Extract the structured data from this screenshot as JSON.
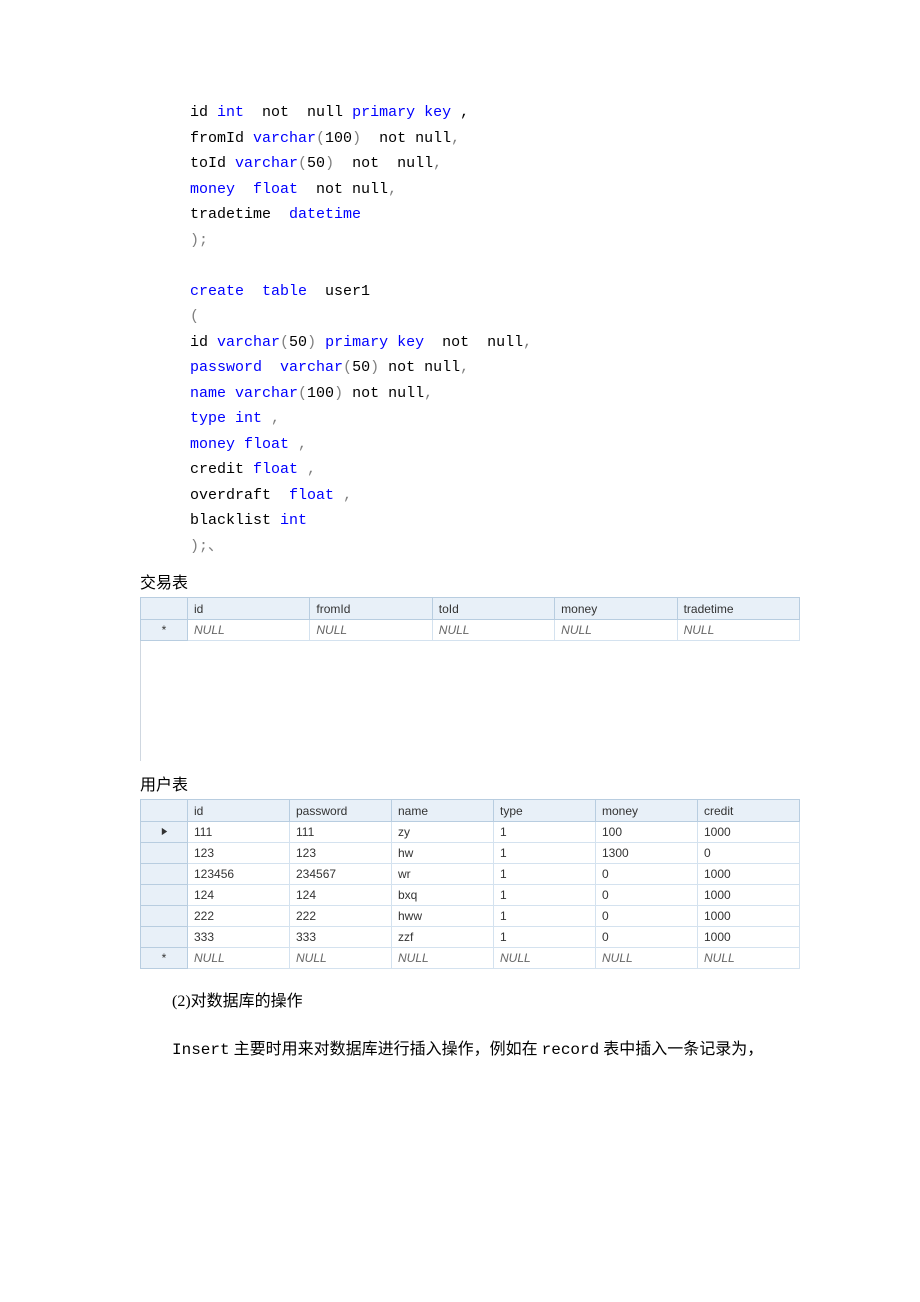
{
  "code_lines": [
    [
      [
        "black",
        "id "
      ],
      [
        "kw",
        "int"
      ],
      [
        "black",
        "  not  null "
      ],
      [
        "kw",
        "primary key"
      ],
      [
        "black",
        " ,"
      ]
    ],
    [
      [
        "black",
        "fromId "
      ],
      [
        "kw",
        "varchar"
      ],
      [
        "gray",
        "("
      ],
      [
        "black",
        "100"
      ],
      [
        "gray",
        ")"
      ],
      [
        "black",
        "  not null"
      ],
      [
        "gray",
        ","
      ]
    ],
    [
      [
        "black",
        "toId "
      ],
      [
        "kw",
        "varchar"
      ],
      [
        "gray",
        "("
      ],
      [
        "black",
        "50"
      ],
      [
        "gray",
        ")"
      ],
      [
        "black",
        "  not  null"
      ],
      [
        "gray",
        ","
      ]
    ],
    [
      [
        "kw",
        "money"
      ],
      [
        "black",
        "  "
      ],
      [
        "kw",
        "float"
      ],
      [
        "black",
        "  not null"
      ],
      [
        "gray",
        ","
      ]
    ],
    [
      [
        "black",
        "tradetime  "
      ],
      [
        "kw",
        "datetime"
      ]
    ],
    [
      [
        "gray",
        ");"
      ]
    ],
    [
      [
        "black",
        ""
      ]
    ],
    [
      [
        "kw",
        "create"
      ],
      [
        "black",
        "  "
      ],
      [
        "kw",
        "table"
      ],
      [
        "black",
        "  user1"
      ]
    ],
    [
      [
        "gray",
        "("
      ]
    ],
    [
      [
        "black",
        "id "
      ],
      [
        "kw",
        "varchar"
      ],
      [
        "gray",
        "("
      ],
      [
        "black",
        "50"
      ],
      [
        "gray",
        ") "
      ],
      [
        "kw",
        "primary key"
      ],
      [
        "black",
        "  not  null"
      ],
      [
        "gray",
        ","
      ]
    ],
    [
      [
        "kw",
        "password"
      ],
      [
        "black",
        "  "
      ],
      [
        "kw",
        "varchar"
      ],
      [
        "gray",
        "("
      ],
      [
        "black",
        "50"
      ],
      [
        "gray",
        ")"
      ],
      [
        "black",
        " not null"
      ],
      [
        "gray",
        ","
      ]
    ],
    [
      [
        "kw",
        "name "
      ],
      [
        "kw",
        "varchar"
      ],
      [
        "gray",
        "("
      ],
      [
        "black",
        "100"
      ],
      [
        "gray",
        ")"
      ],
      [
        "black",
        " not null"
      ],
      [
        "gray",
        ","
      ]
    ],
    [
      [
        "kw",
        "type int"
      ],
      [
        "black",
        " "
      ],
      [
        "gray",
        ","
      ]
    ],
    [
      [
        "kw",
        "money float"
      ],
      [
        "black",
        " "
      ],
      [
        "gray",
        ","
      ]
    ],
    [
      [
        "black",
        "credit "
      ],
      [
        "kw",
        "float"
      ],
      [
        "black",
        " "
      ],
      [
        "gray",
        ","
      ]
    ],
    [
      [
        "black",
        "overdraft  "
      ],
      [
        "kw",
        "float"
      ],
      [
        "black",
        " "
      ],
      [
        "gray",
        ","
      ]
    ],
    [
      [
        "black",
        "blacklist "
      ],
      [
        "kw",
        "int"
      ]
    ],
    [
      [
        "gray",
        ");、"
      ]
    ]
  ],
  "label_trade": "交易表",
  "label_user": "用户表",
  "null_text": "NULL",
  "table1": {
    "headers": [
      "id",
      "fromId",
      "toId",
      "money",
      "tradetime"
    ],
    "rows": [
      {
        "gutter": "*",
        "cells": [
          "NULL",
          "NULL",
          "NULL",
          "NULL",
          "NULL"
        ],
        "null_row": true
      }
    ]
  },
  "table2": {
    "headers": [
      "id",
      "password",
      "name",
      "type",
      "money",
      "credit"
    ],
    "rows": [
      {
        "gutter": "▶",
        "cells": [
          "111",
          "111",
          "zy",
          "1",
          "100",
          "1000"
        ]
      },
      {
        "gutter": "",
        "cells": [
          "123",
          "123",
          "hw",
          "1",
          "1300",
          "0"
        ]
      },
      {
        "gutter": "",
        "cells": [
          "123456",
          "234567",
          "wr",
          "1",
          "0",
          "1000"
        ]
      },
      {
        "gutter": "",
        "cells": [
          "124",
          "124",
          "bxq",
          "1",
          "0",
          "1000"
        ]
      },
      {
        "gutter": "",
        "cells": [
          "222",
          "222",
          "hww",
          "1",
          "0",
          "1000"
        ]
      },
      {
        "gutter": "",
        "cells": [
          "333",
          "333",
          "zzf",
          "1",
          "0",
          "1000"
        ]
      },
      {
        "gutter": "*",
        "cells": [
          "NULL",
          "NULL",
          "NULL",
          "NULL",
          "NULL",
          "NULL"
        ],
        "null_row": true
      }
    ]
  },
  "body": {
    "section_no": "(2)对数据库的操作",
    "para1_a": "Insert",
    "para1_b": " 主要时用来对数据库进行插入操作，例如在 ",
    "para1_c": "record",
    "para1_d": " 表中插入一条记录为，"
  }
}
